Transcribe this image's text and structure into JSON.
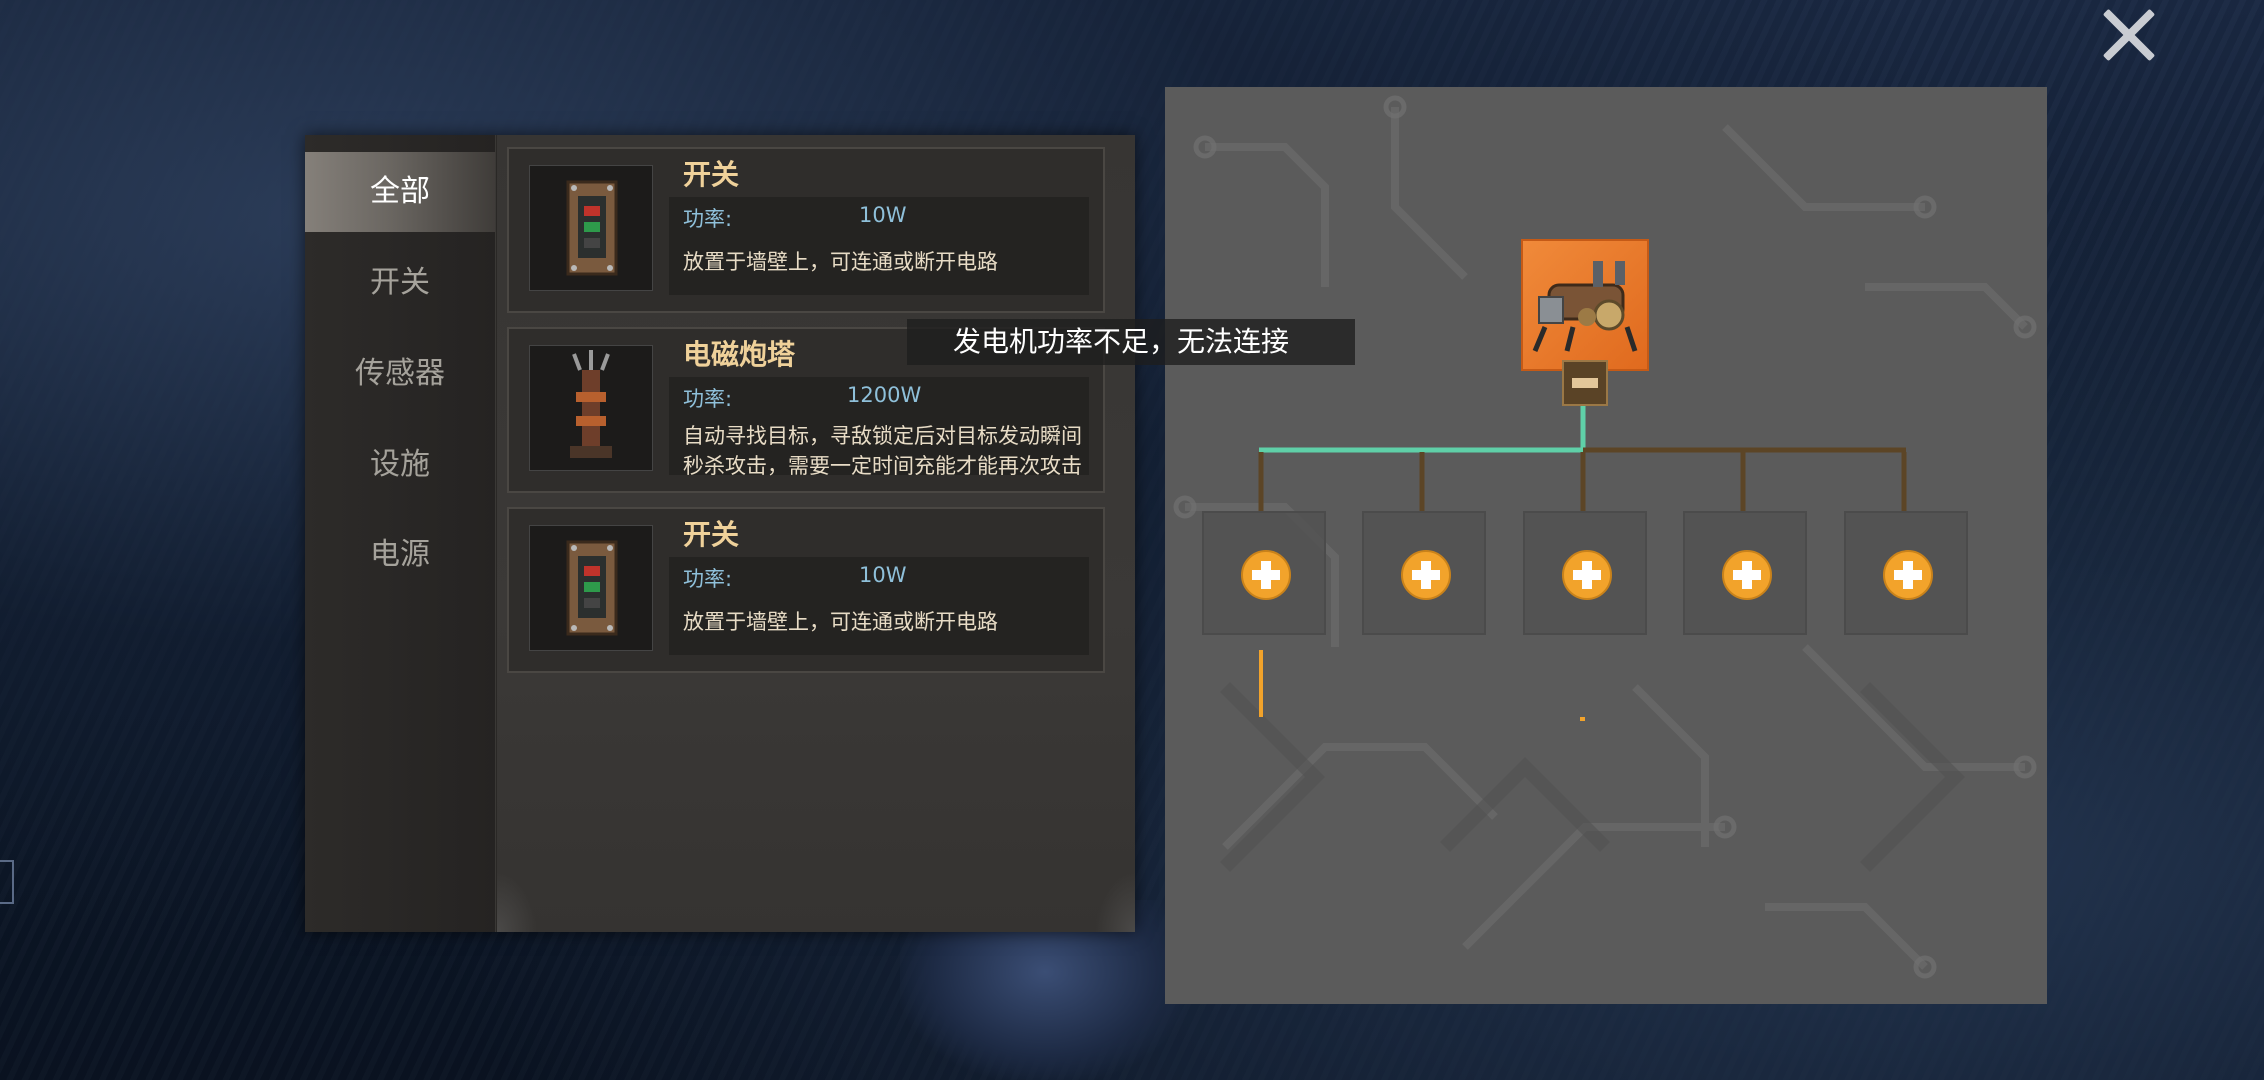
{
  "categories": [
    {
      "label": "全部",
      "active": true
    },
    {
      "label": "开关",
      "active": false
    },
    {
      "label": "传感器",
      "active": false
    },
    {
      "label": "设施",
      "active": false
    },
    {
      "label": "电源",
      "active": false
    }
  ],
  "items": [
    {
      "name": "开关",
      "power_label": "功率:",
      "power_value": "10W",
      "description": "放置于墙壁上，可连通或断开电路",
      "icon": "switch-panel-icon"
    },
    {
      "name": "电磁炮塔",
      "power_label": "功率:",
      "power_value": "1200W",
      "description": "自动寻找目标，寻敌锁定后对目标发动瞬间秒杀攻击，需要一定时间充能才能再次攻击",
      "icon": "emp-turret-icon"
    },
    {
      "name": "开关",
      "power_label": "功率:",
      "power_value": "10W",
      "description": "放置于墙壁上，可连通或断开电路",
      "icon": "switch-panel-icon"
    }
  ],
  "toast": {
    "message": "发电机功率不足，无法连接"
  },
  "circuit": {
    "generator_icon": "generator-icon",
    "slot_count": 5,
    "active_wire_color": "#5fd0a8",
    "inactive_wire_color": "#5c4526",
    "accent_color": "#f2a32b"
  }
}
